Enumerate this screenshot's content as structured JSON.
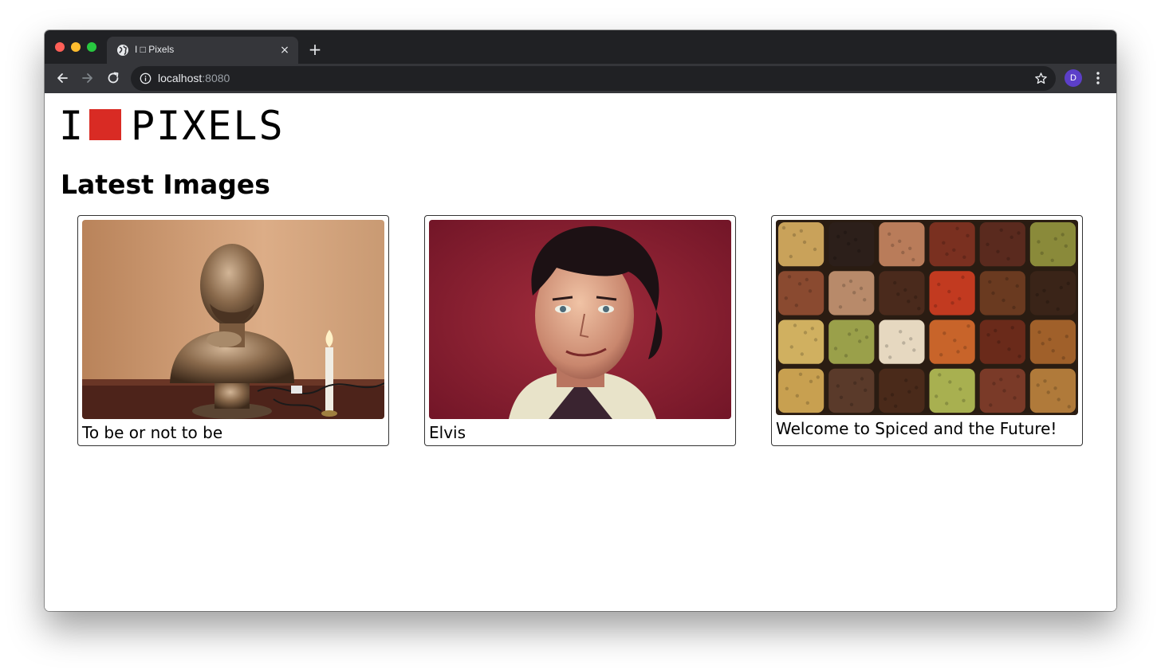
{
  "browser": {
    "tab": {
      "title": "I □ Pixels",
      "favicon": "globe-icon",
      "close_icon": "×"
    },
    "new_tab_icon": "+",
    "address_bar": {
      "host": "localhost",
      "port": ":8080"
    },
    "profile_initial": "D",
    "avatar_color": "#5c3fc9"
  },
  "page": {
    "logo": {
      "left_letter": "I",
      "word": "PIXELS",
      "square_color": "#d92b24"
    },
    "heading": "Latest Images",
    "images": [
      {
        "caption": "To be or not to be",
        "subject": "shakespeare-bust-photo"
      },
      {
        "caption": "Elvis",
        "subject": "elvis-portrait-photo"
      },
      {
        "caption": "Welcome to Spiced and the Future!",
        "subject": "spices-grid-photo"
      }
    ]
  }
}
